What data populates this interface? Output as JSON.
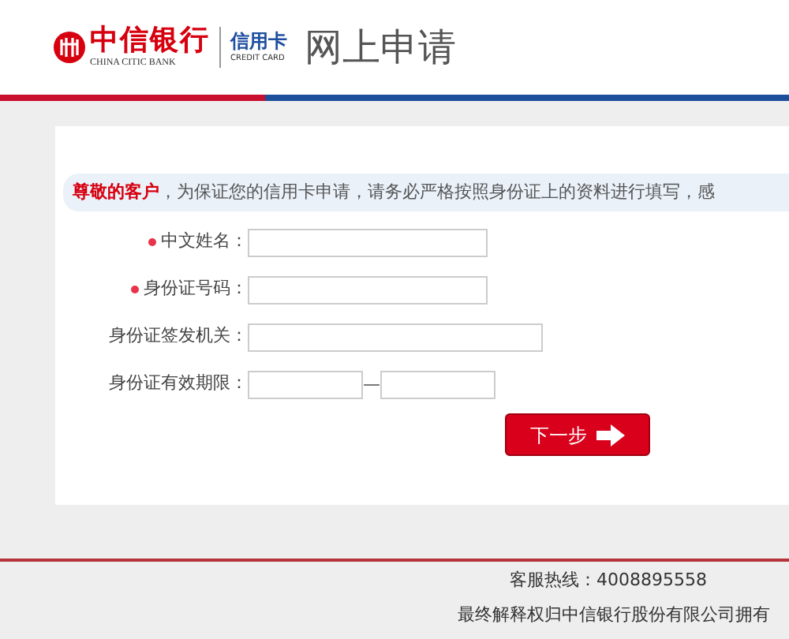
{
  "header": {
    "bank_name": "中信银行",
    "bank_name_en": "CHINA CITIC BANK",
    "card_label": "信用卡",
    "card_label_en": "CREDIT CARD",
    "page_title": "网上申请"
  },
  "notice": "**尊敬的客户**，为保证您的信用卡申请，请务必严格按照身份证上的资料进行填写，感",
  "fields": [
    {
      "label": "中文姓名：",
      "required": true,
      "kind": "text"
    },
    {
      "label": "身份证号码：",
      "required": true,
      "kind": "text"
    },
    {
      "label": "身份证签发机关：",
      "required": false,
      "kind": "wide"
    },
    {
      "label": "身份证有效期限：",
      "required": false,
      "kind": "range",
      "separator": "—"
    }
  ],
  "next_button": "下一步",
  "footer": {
    "hotline": "客服热线：4008895558",
    "copyright": "最终解释权归中信银行股份有限公司拥有"
  }
}
